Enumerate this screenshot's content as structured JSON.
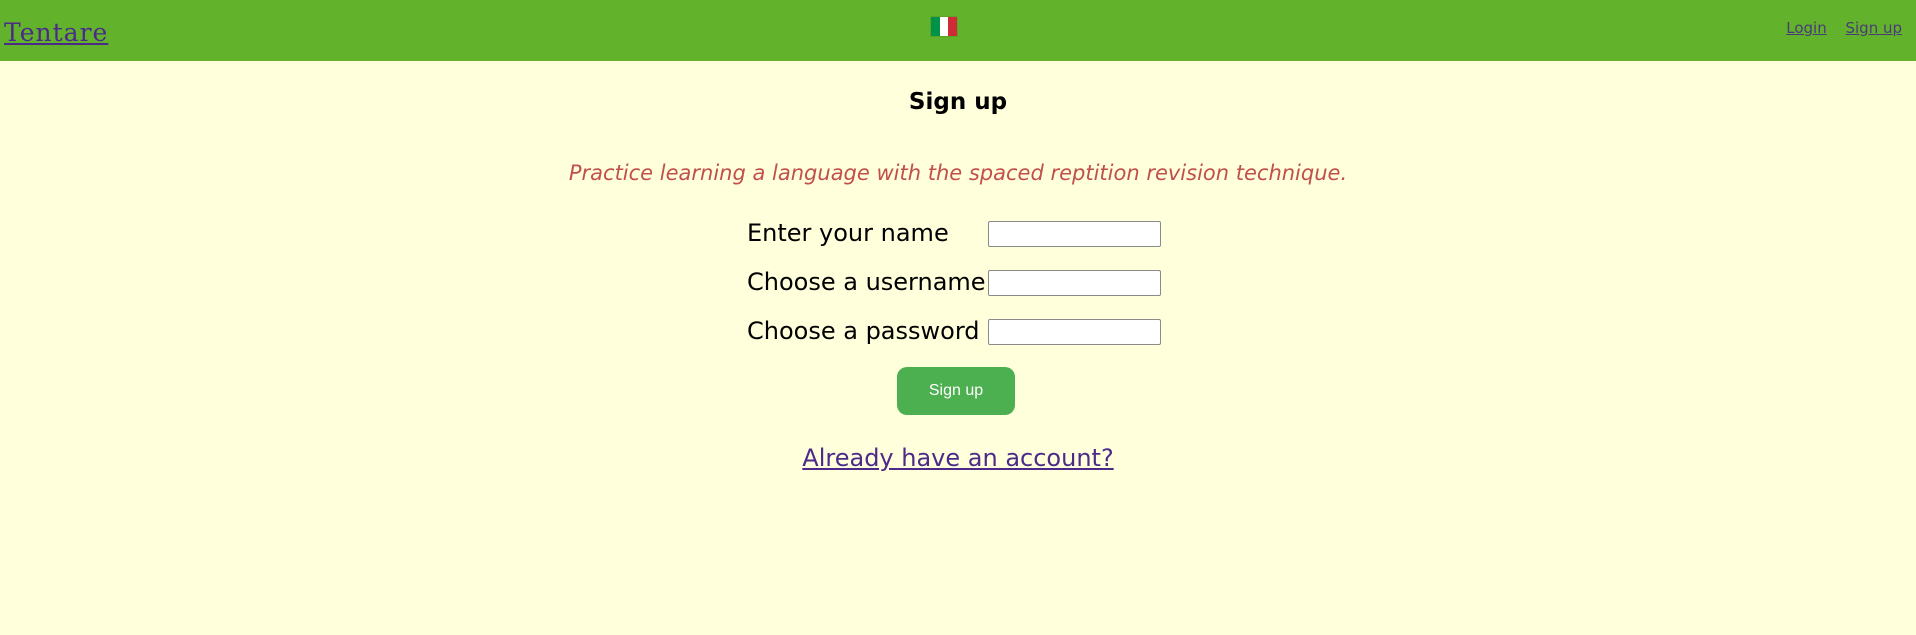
{
  "header": {
    "brand": "Tentare",
    "flag_colors": [
      "#009246",
      "#ffffff",
      "#ce2b37"
    ],
    "nav": {
      "login": "Login",
      "signup": "Sign up"
    }
  },
  "main": {
    "title": "Sign up",
    "tagline": "Practice learning a language with the spaced reptition revision technique.",
    "fields": {
      "name": {
        "label": "Enter your name",
        "value": ""
      },
      "username": {
        "label": "Choose a username",
        "value": ""
      },
      "password": {
        "label": "Choose a password",
        "value": ""
      }
    },
    "submit_label": "Sign up",
    "account_link": "Already have an account?"
  },
  "colors": {
    "header_bg": "#62b32b",
    "page_bg": "#ffffdc",
    "button_bg": "#4caf50",
    "tagline": "#c1504d",
    "link": "#4b2a8a"
  }
}
